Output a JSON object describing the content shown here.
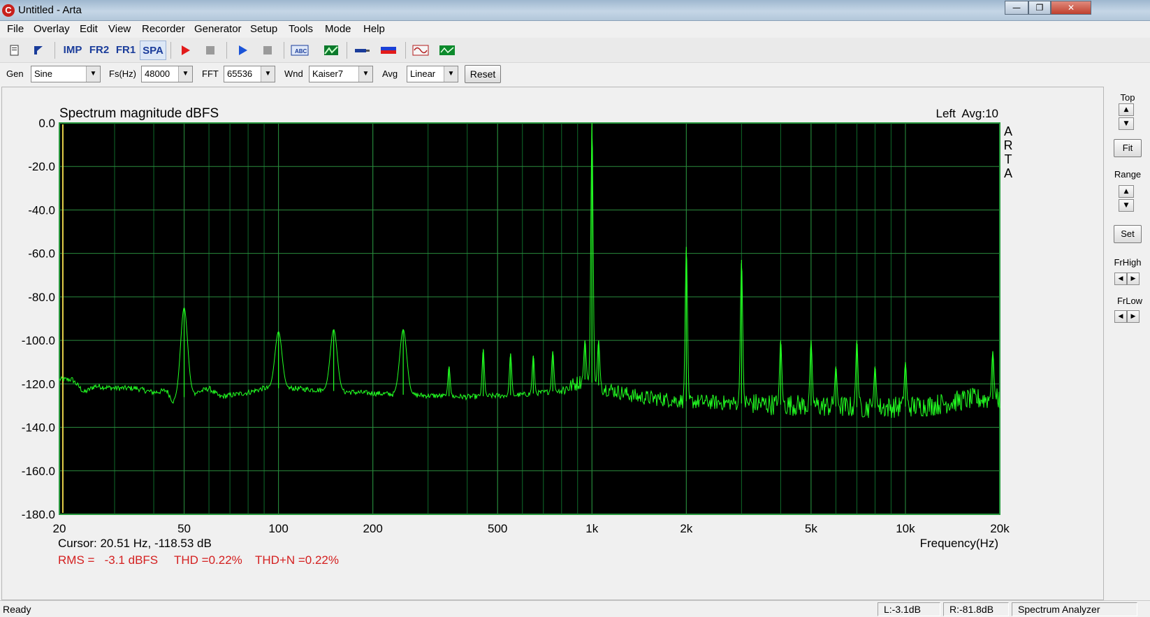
{
  "window": {
    "title": "Untitled - Arta",
    "app_icon": "arta-icon",
    "controls": {
      "minimize": "—",
      "restore": "❐",
      "close": "✕"
    }
  },
  "menu": [
    "File",
    "Overlay",
    "Edit",
    "View",
    "Recorder",
    "Generator",
    "Setup",
    "Tools",
    "Mode",
    "Help"
  ],
  "toolbar": {
    "new_icon": "new-file-icon",
    "open_icon": "open-file-icon",
    "imp": "IMP",
    "fr2": "FR2",
    "fr1": "FR1",
    "spa": "SPA",
    "record_icon": "record-icon",
    "stop_icon": "stop-icon",
    "play_icon": "play-icon",
    "stop2_icon": "stop-icon",
    "icons_right": [
      "label-icon",
      "overlay-icon",
      "probe-icon",
      "color-icon",
      "signal-icon",
      "scope-icon"
    ]
  },
  "params": {
    "gen_label": "Gen",
    "gen_value": "Sine",
    "fs_label": "Fs(Hz)",
    "fs_value": "48000",
    "fft_label": "FFT",
    "fft_value": "65536",
    "wnd_label": "Wnd",
    "wnd_value": "Kaiser7",
    "avg_label": "Avg",
    "avg_value": "Linear",
    "reset": "Reset"
  },
  "chart_data": {
    "type": "line",
    "title": "Spectrum magnitude dBFS",
    "channel_info": "Left  Avg:10",
    "xlabel": "Frequency(Hz)",
    "xscale": "log",
    "xlim": [
      20,
      20000
    ],
    "ylim": [
      -180,
      0
    ],
    "x_ticks": [
      {
        "value": 20,
        "label": "20"
      },
      {
        "value": 50,
        "label": "50"
      },
      {
        "value": 100,
        "label": "100"
      },
      {
        "value": 200,
        "label": "200"
      },
      {
        "value": 500,
        "label": "500"
      },
      {
        "value": 1000,
        "label": "1k"
      },
      {
        "value": 2000,
        "label": "2k"
      },
      {
        "value": 5000,
        "label": "5k"
      },
      {
        "value": 10000,
        "label": "10k"
      },
      {
        "value": 20000,
        "label": "20k"
      }
    ],
    "y_ticks": [
      {
        "value": 0,
        "label": "0.0"
      },
      {
        "value": -20,
        "label": "-20.0"
      },
      {
        "value": -40,
        "label": "-40.0"
      },
      {
        "value": -60,
        "label": "-60.0"
      },
      {
        "value": -80,
        "label": "-80.0"
      },
      {
        "value": -100,
        "label": "-100.0"
      },
      {
        "value": -120,
        "label": "-120.0"
      },
      {
        "value": -140,
        "label": "-140.0"
      },
      {
        "value": -160,
        "label": "-160.0"
      },
      {
        "value": -180,
        "label": "-180.0"
      }
    ],
    "grid": true,
    "background": "#000000",
    "grid_color": "#0f6b2a",
    "line_color": "#22ff22",
    "cursor_color": "#e8d24a",
    "watermark": [
      "A",
      "R",
      "T",
      "A"
    ],
    "noise_floor": [
      {
        "x": 20,
        "y": -118
      },
      {
        "x": 22,
        "y": -118
      },
      {
        "x": 24,
        "y": -124
      },
      {
        "x": 26,
        "y": -121
      },
      {
        "x": 30,
        "y": -122
      },
      {
        "x": 35,
        "y": -122
      },
      {
        "x": 40,
        "y": -124
      },
      {
        "x": 44,
        "y": -123
      },
      {
        "x": 46,
        "y": -128
      },
      {
        "x": 60,
        "y": -122
      },
      {
        "x": 65,
        "y": -126
      },
      {
        "x": 80,
        "y": -124
      },
      {
        "x": 90,
        "y": -122
      },
      {
        "x": 110,
        "y": -122
      },
      {
        "x": 140,
        "y": -123
      },
      {
        "x": 180,
        "y": -124
      },
      {
        "x": 250,
        "y": -125
      },
      {
        "x": 400,
        "y": -126
      },
      {
        "x": 600,
        "y": -125
      },
      {
        "x": 800,
        "y": -123
      },
      {
        "x": 950,
        "y": -118
      },
      {
        "x": 1100,
        "y": -122
      },
      {
        "x": 1400,
        "y": -126
      },
      {
        "x": 2000,
        "y": -128
      },
      {
        "x": 3000,
        "y": -129
      },
      {
        "x": 5000,
        "y": -130
      },
      {
        "x": 8000,
        "y": -131
      },
      {
        "x": 12000,
        "y": -130
      },
      {
        "x": 16000,
        "y": -127
      },
      {
        "x": 20000,
        "y": -127
      }
    ],
    "peaks": [
      {
        "x": 50,
        "y": -85
      },
      {
        "x": 100,
        "y": -96
      },
      {
        "x": 150,
        "y": -95
      },
      {
        "x": 250,
        "y": -95
      },
      {
        "x": 350,
        "y": -112
      },
      {
        "x": 450,
        "y": -104
      },
      {
        "x": 550,
        "y": -106
      },
      {
        "x": 650,
        "y": -107
      },
      {
        "x": 750,
        "y": -105
      },
      {
        "x": 950,
        "y": -100
      },
      {
        "x": 1000,
        "y": 0
      },
      {
        "x": 1050,
        "y": -100
      },
      {
        "x": 2000,
        "y": -57
      },
      {
        "x": 3000,
        "y": -63
      },
      {
        "x": 4000,
        "y": -100
      },
      {
        "x": 5000,
        "y": -100
      },
      {
        "x": 6000,
        "y": -112
      },
      {
        "x": 7000,
        "y": -100
      },
      {
        "x": 8000,
        "y": -112
      },
      {
        "x": 10000,
        "y": -110
      },
      {
        "x": 19000,
        "y": -105
      }
    ],
    "cursor": {
      "x": 20.51,
      "y": -118.53
    },
    "readout": {
      "cursor": "Cursor: 20.51 Hz, -118.53 dB",
      "rms": "RMS =   -3.1 dBFS",
      "thd": "THD =0.22%",
      "thdn": "THD+N =0.22%"
    }
  },
  "side": {
    "top": "Top",
    "fit": "Fit",
    "range": "Range",
    "set": "Set",
    "frhigh": "FrHigh",
    "frlow": "FrLow",
    "up": "▲",
    "down": "▼",
    "left": "◀",
    "right": "▶"
  },
  "status": {
    "ready": "Ready",
    "left_level": "L:-3.1dB",
    "right_level": "R:-81.8dB",
    "mode": "Spectrum Analyzer"
  }
}
